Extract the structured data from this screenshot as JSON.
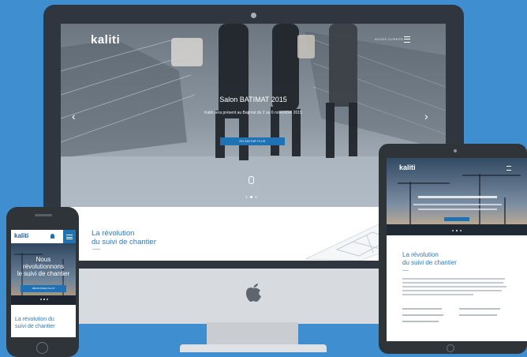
{
  "colors": {
    "background": "#3f8fd0",
    "accent": "#1f73b5",
    "heading": "#2d79bd",
    "device_frame": "#2f3640"
  },
  "desktop": {
    "logo": "kaliti",
    "menu_label": "ACCES CLIENTS",
    "hero_title": "Salon BATIMAT 2015",
    "hero_subtitle": "Kaliti sera présent au Batimat du 2 au 6 novembre 2015",
    "cta_label": "EN SAVOIR PLUS",
    "section_heading_line1": "La révolution",
    "section_heading_line2": "du suivi de chantier",
    "icons": [
      "menu-icon",
      "arrow-left-icon",
      "arrow-right-icon",
      "scroll-mouse-icon",
      "apple-logo"
    ]
  },
  "tablet": {
    "logo": "kaliti",
    "section_heading_line1": "La révolution",
    "section_heading_line2": "du suivi de chantier"
  },
  "phone": {
    "logo": "kaliti",
    "hero_title_line1": "Nous",
    "hero_title_line2": "révolutionnons",
    "hero_title_line3": "le suivi de chantier",
    "cta_label": "DÉCOUVREZ KALITI",
    "section_heading_line1": "La révolution du",
    "section_heading_line2": "suivi de chantier"
  }
}
